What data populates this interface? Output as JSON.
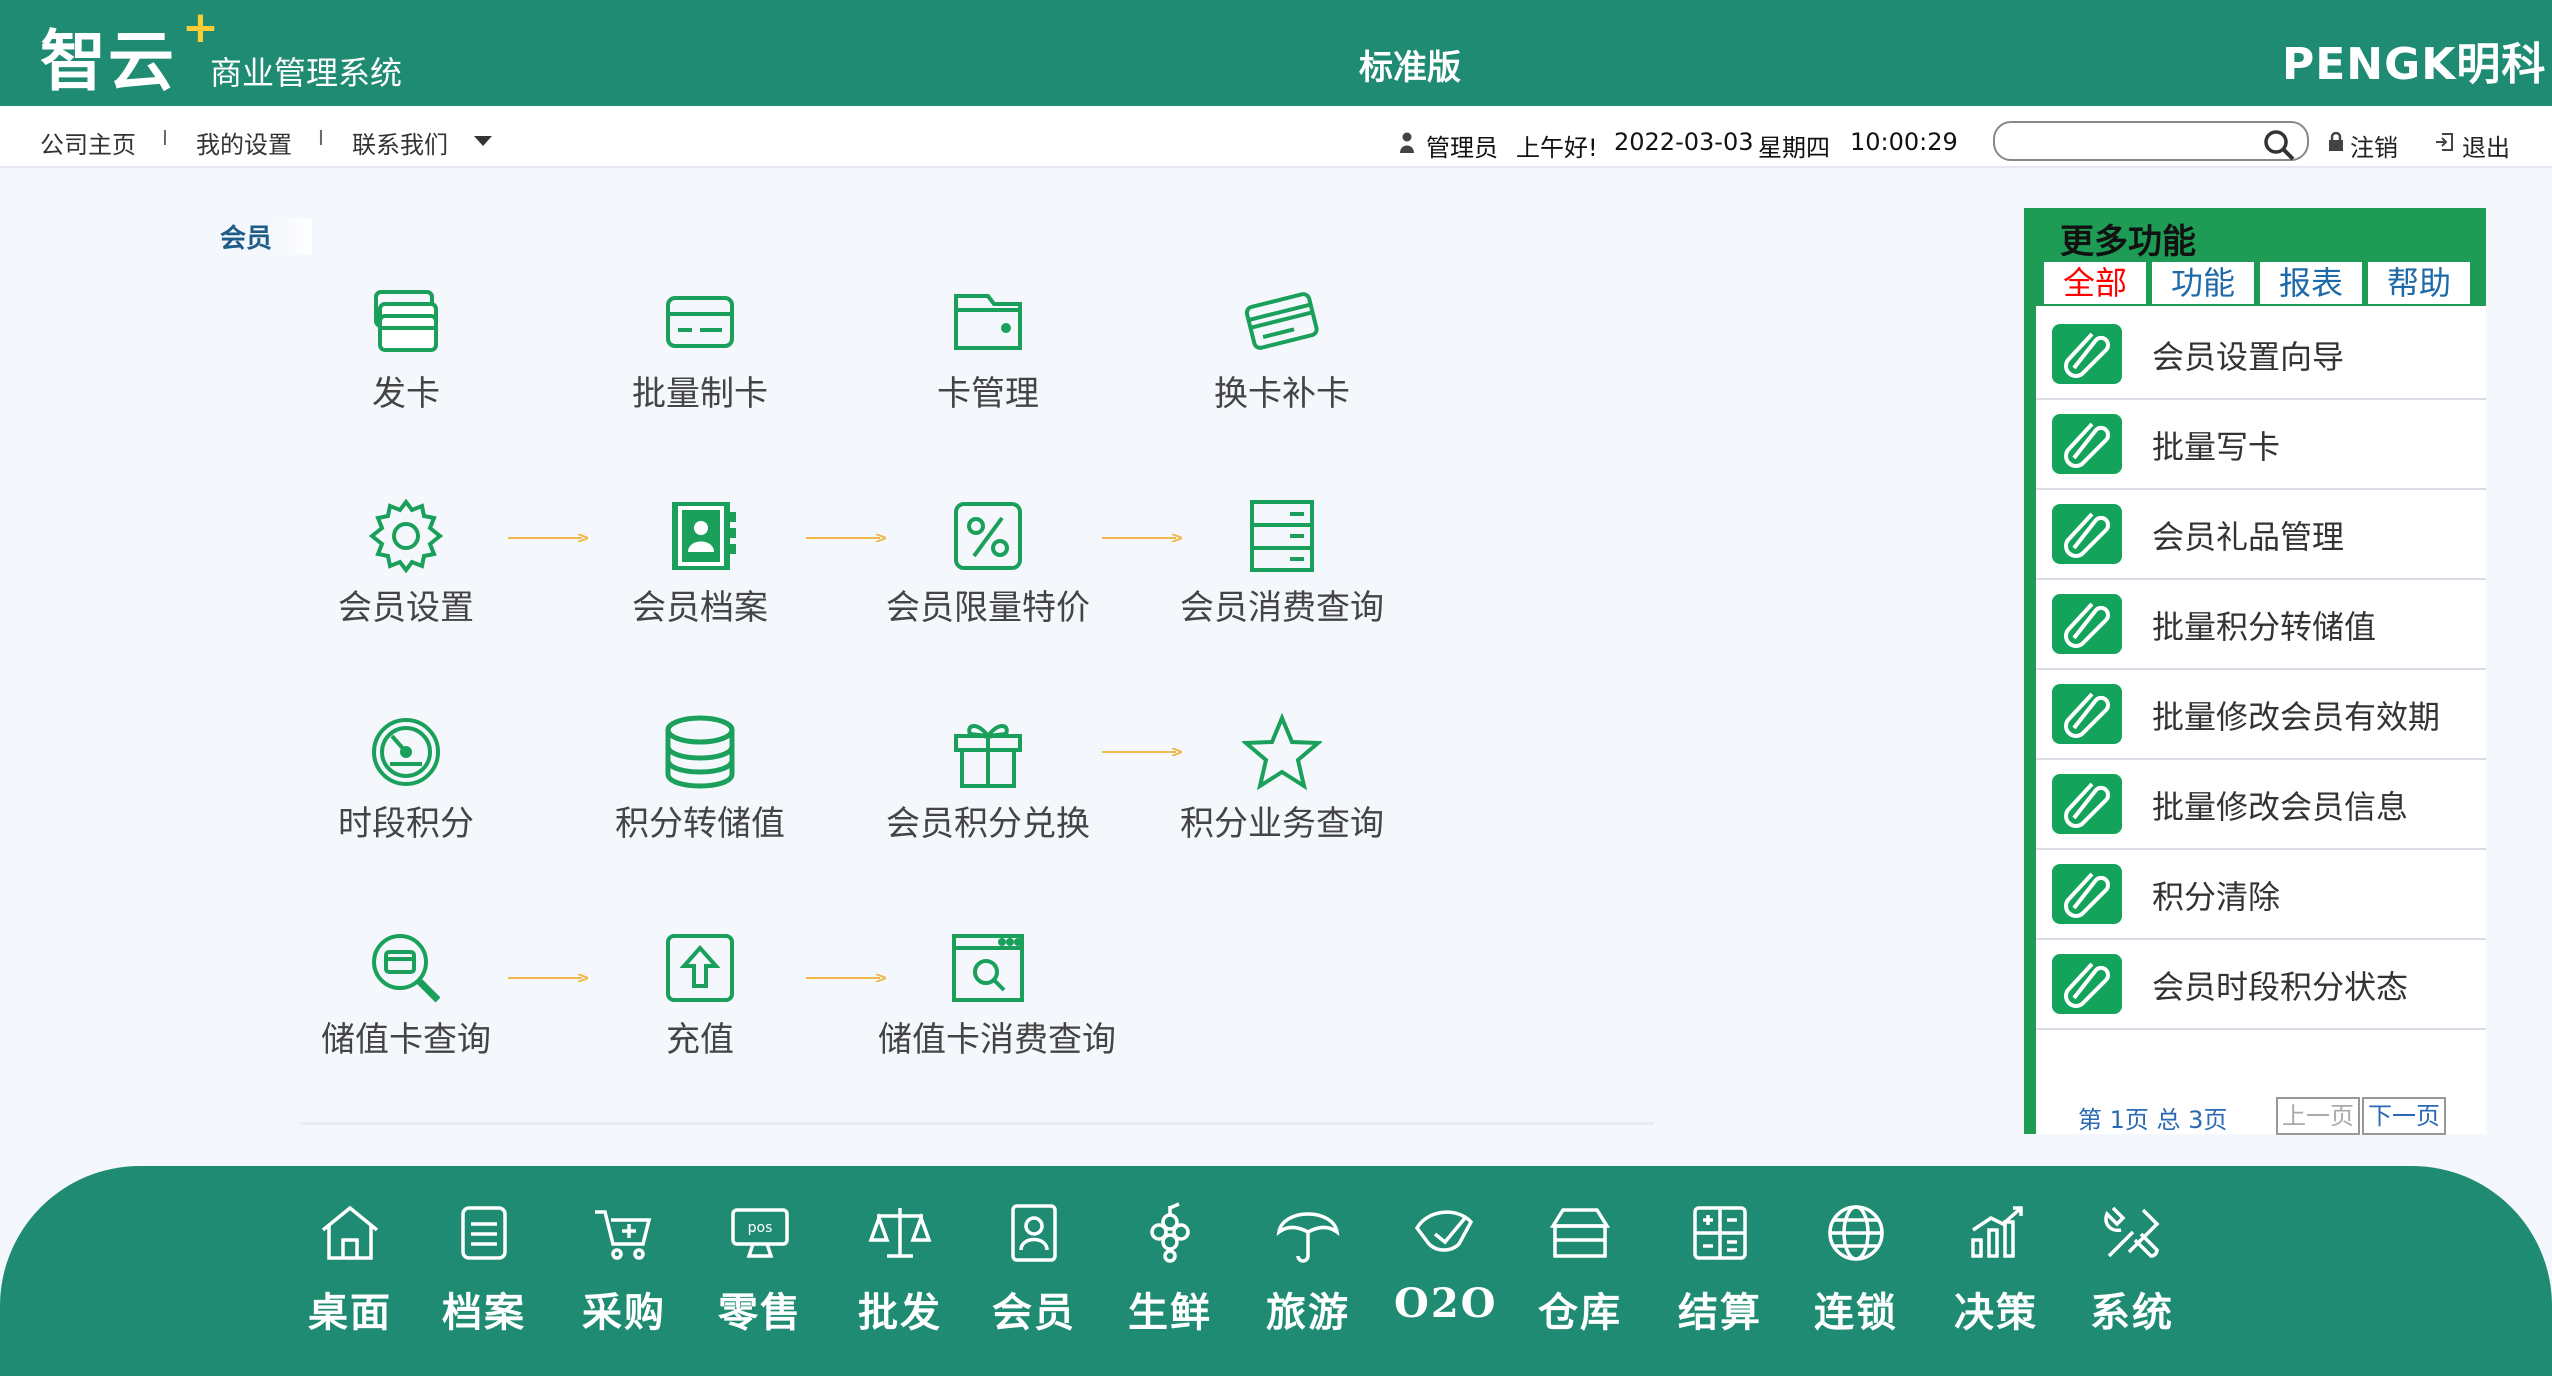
{
  "header": {
    "logo_main": "智云",
    "logo_sub": "商业管理系统",
    "edition": "标准版",
    "brand": "PENGK明科"
  },
  "nav": {
    "items": [
      "公司主页",
      "我的设置",
      "联系我们"
    ],
    "separator": "I"
  },
  "status": {
    "user": "管理员",
    "greeting": "上午好!",
    "date": "2022-03-03",
    "weekday": "星期四",
    "time": "10:00:29"
  },
  "search": {
    "value": "",
    "placeholder": ""
  },
  "top_actions": {
    "logout": "注销",
    "exit": "退出"
  },
  "section": {
    "label": "会员"
  },
  "functions": {
    "fa": "发卡",
    "fb": "批量制卡",
    "fc": "卡管理",
    "fd": "换卡补卡",
    "fe": "会员设置",
    "ff": "会员档案",
    "fg": "会员限量特价",
    "fh": "会员消费查询",
    "fi": "时段积分",
    "fj": "积分转储值",
    "fk": "会员积分兑换",
    "fl": "积分业务查询",
    "fm": "储值卡查询",
    "fn": "充值",
    "fo": "储值卡消费查询"
  },
  "panel": {
    "title": "更多功能",
    "tabs": [
      "全部",
      "功能",
      "报表",
      "帮助"
    ],
    "active_tab_color": "#ff0000",
    "items": [
      "会员设置向导",
      "批量写卡",
      "会员礼品管理",
      "批量积分转储值",
      "批量修改会员有效期",
      "批量修改会员信息",
      "积分清除",
      "会员时段积分状态"
    ],
    "pager": {
      "info": "第 1页 总 3页",
      "prev": "上一页",
      "next": "下一页"
    }
  },
  "dock": {
    "items": [
      "桌面",
      "档案",
      "采购",
      "零售",
      "批发",
      "会员",
      "生鲜",
      "旅游",
      "O2O",
      "仓库",
      "结算",
      "连锁",
      "决策",
      "系统"
    ]
  },
  "colors": {
    "primary": "#1e8b72",
    "panel_green": "#1e9b55",
    "icon_green": "#1aa05a",
    "arrow": "#f2b64a"
  }
}
